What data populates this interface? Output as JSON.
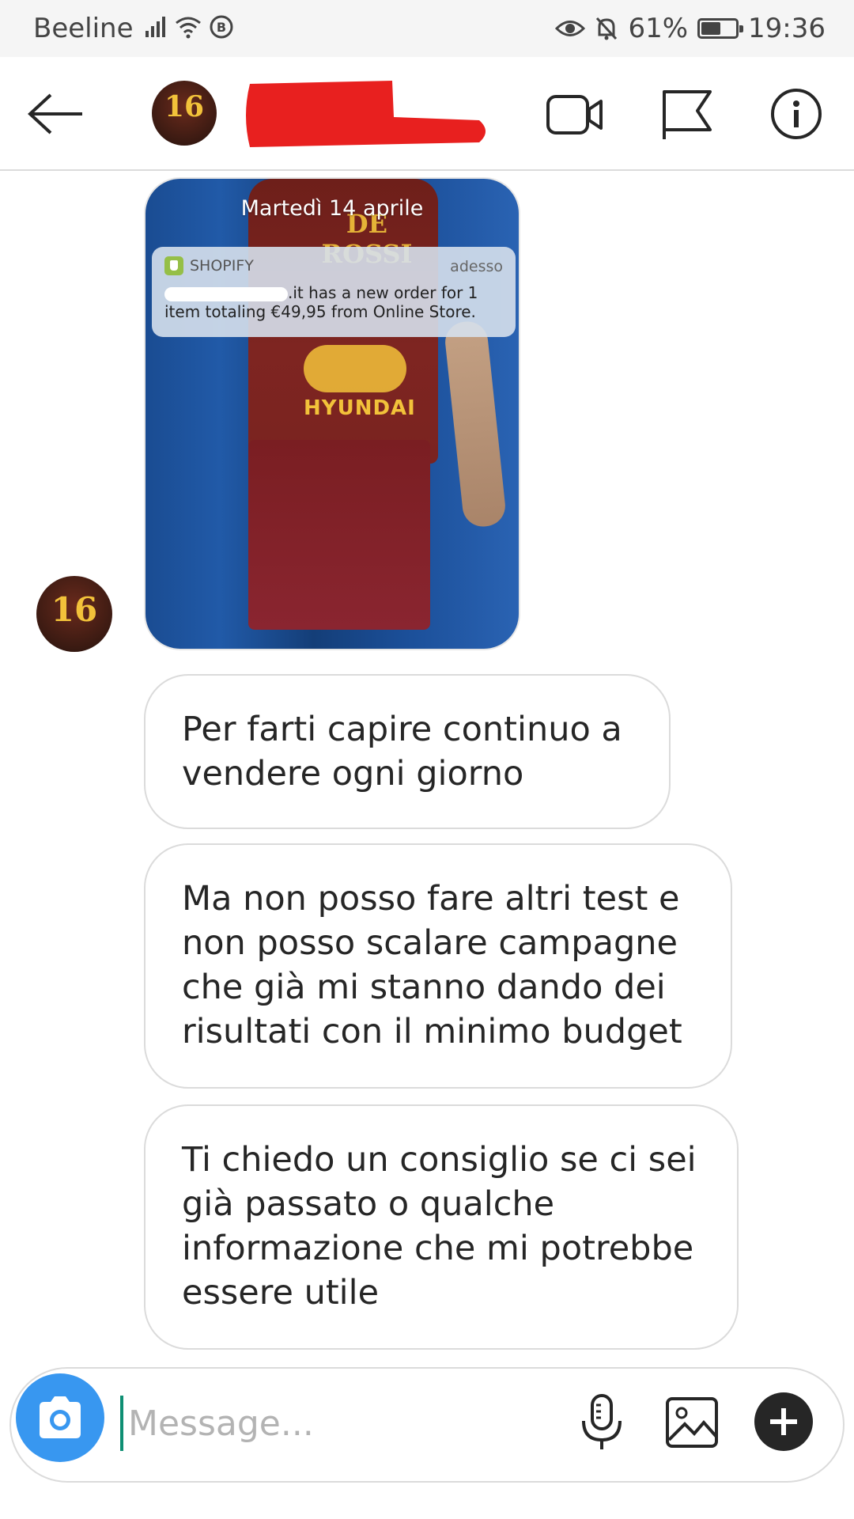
{
  "status_bar": {
    "carrier": "Beeline",
    "battery": "61%",
    "battery_level": 0.61,
    "time": "19:36",
    "icons": [
      "signal-icon",
      "wifi-icon",
      "data-saver-icon",
      "eye-icon",
      "bell-off-icon",
      "battery-icon"
    ]
  },
  "header": {
    "icons": [
      "back-arrow-icon",
      "video-call-icon",
      "flag-icon",
      "info-icon"
    ],
    "avatar_number": "16"
  },
  "messages": {
    "image": {
      "lock_date": "Martedì 14 aprile",
      "notification": {
        "app": "SHOPIFY",
        "time": "adesso",
        "text_end": ".it has a new order for 1",
        "text_line2": "item totaling €49,95 from Online Store."
      },
      "jersey_name": "DE ROSSI",
      "sponsor": "HYUNDAI"
    },
    "bubble1": "Per farti capire continuo a vendere ogni giorno",
    "bubble2": "Ma non posso fare altri test e non posso scalare campagne che già mi stanno dando dei risultati con il minimo budget",
    "bubble3": "Ti chiedo un consiglio se ci sei già passato o qualche informazione che mi potrebbe essere utile"
  },
  "composer": {
    "placeholder": "Message...",
    "icons": [
      "camera-icon",
      "microphone-icon",
      "gallery-icon",
      "plus-icon"
    ]
  },
  "colors": {
    "accent_blue": "#3897f0",
    "redaction_red": "#e8201f",
    "bubble_border": "#dbdbdb"
  }
}
